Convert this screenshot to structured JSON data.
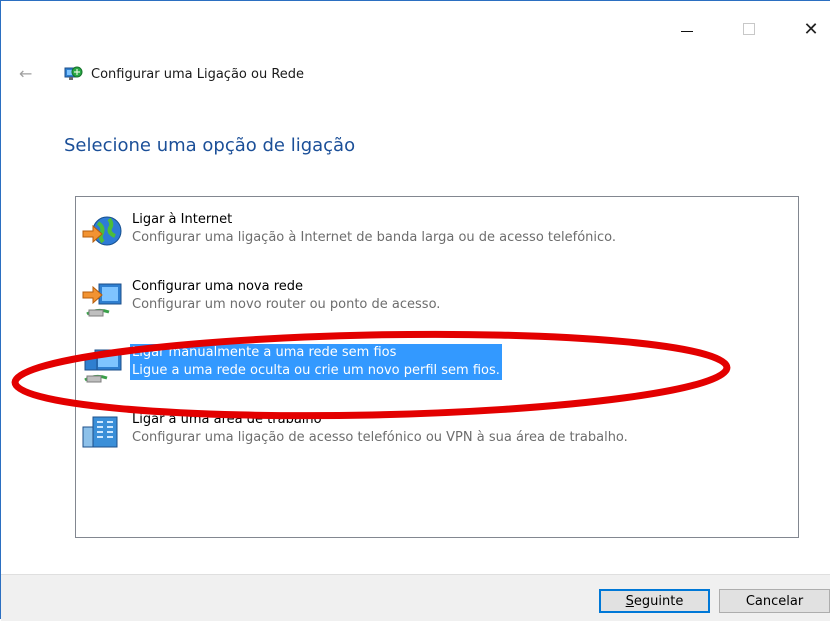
{
  "window": {
    "title": "Configurar uma Ligação ou Rede",
    "controls": {
      "minimize": "—",
      "maximize": "☐",
      "close": "✕"
    },
    "back_glyph": "←"
  },
  "heading": "Selecione uma opção de ligação",
  "options": [
    {
      "title": "Ligar à Internet",
      "description": "Configurar uma ligação à Internet de banda larga ou de acesso telefónico.",
      "icon": "globe-icon"
    },
    {
      "title": "Configurar uma nova rede",
      "description": "Configurar um novo router ou ponto de acesso.",
      "icon": "router-icon"
    },
    {
      "title": "Ligar manualmente a uma rede sem fios",
      "description": "Ligue a uma rede oculta ou crie um novo perfil sem fios.",
      "icon": "wireless-network-icon",
      "selected": true
    },
    {
      "title": "Ligar a uma área de trabalho",
      "description": "Configurar uma ligação de acesso telefónico ou VPN à sua área de trabalho.",
      "icon": "workplace-icon"
    }
  ],
  "buttons": {
    "next": "Seguinte",
    "cancel": "Cancelar"
  },
  "colors": {
    "accent": "#0078d7",
    "heading": "#1b4f98",
    "selection": "#3399ff",
    "annotation": "#e30000"
  }
}
